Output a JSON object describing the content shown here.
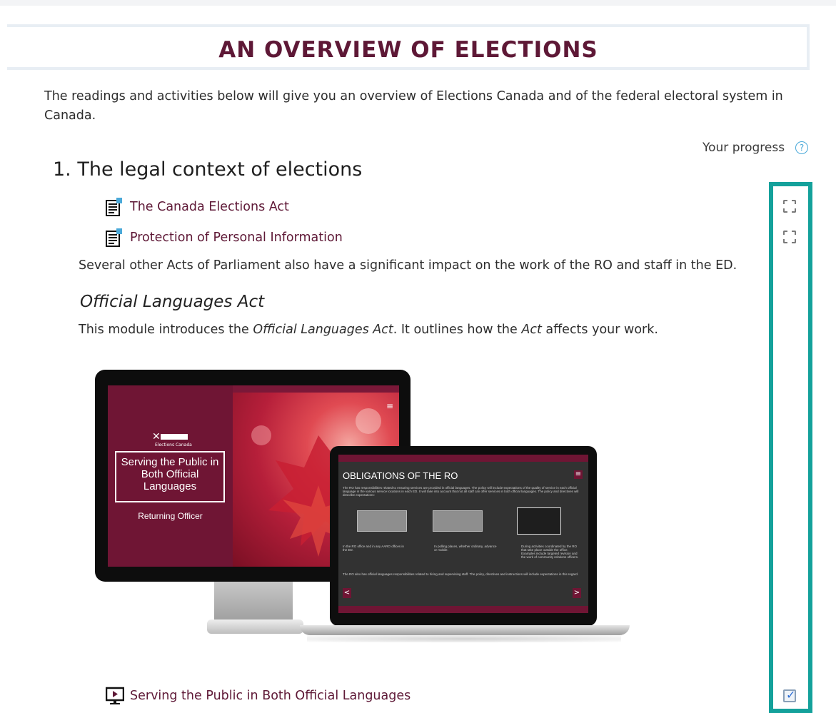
{
  "page": {
    "title": "AN OVERVIEW OF ELECTIONS",
    "intro": "The readings and activities below will give you an overview of Elections Canada and of the federal electoral system in Canada."
  },
  "progress": {
    "label": "Your progress",
    "help_glyph": "?"
  },
  "section": {
    "heading": "1. The legal context of elections",
    "activities": [
      {
        "label": "The Canada Elections Act",
        "icon": "book-icon",
        "completed": false
      },
      {
        "label": "Protection of Personal Information",
        "icon": "book-icon",
        "completed": false
      }
    ],
    "note": "Several other Acts of Parliament also have a significant impact on the work of the RO and staff in the ED.",
    "subheading": "Official Languages Act",
    "module_text": {
      "before": "This module introduces the ",
      "italic1": "Official Languages Act",
      "middle": ". It outlines how the ",
      "italic2": "Act",
      "after": " affects your work."
    },
    "module_link": {
      "label": "Serving the Public in Both Official Languages",
      "icon": "presentation-icon",
      "completed": true
    }
  },
  "illustration": {
    "monitor": {
      "logo_caption": "Elections Canada",
      "boxed_title": "Serving the Public in Both Official Languages",
      "subtitle": "Returning Officer",
      "menu_glyph": "≡"
    },
    "laptop": {
      "title": "OBLIGATIONS OF THE RO",
      "menu_glyph": "≡",
      "para1": "The RO has responsibilities related to ensuring services are provided in official languages. The policy will include expectations of the quality of service in each official language in the various service locations in each ED. It will take into account that not all staff can offer services in both official languages. The policy and directives will describe expectations:",
      "captions": [
        "In the RO office and in any AARO offices in the ED.",
        "In polling places, whether ordinary, advance or mobile.",
        "During activities coordinated by the RO that take place outside the office. Examples include targeted revision and the work of community relations officers."
      ],
      "para2": "The RO also has official languages responsibilities related to hiring and supervising staff. The policy, directives and instructions will include expectations in this regard.",
      "prev_glyph": "<",
      "next_glyph": ">"
    }
  },
  "colors": {
    "accent_maroon": "#5e1836",
    "highlight_teal": "#14a19b",
    "help_blue": "#4aa9d9"
  }
}
